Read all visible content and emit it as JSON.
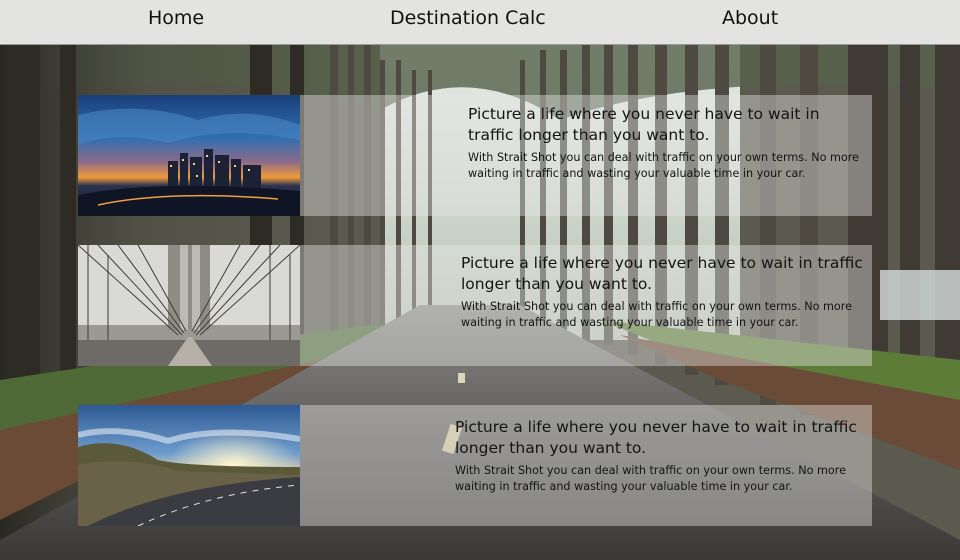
{
  "nav": {
    "home_label": "Home",
    "calc_label": "Destination Calc",
    "about_label": "About"
  },
  "cards": [
    {
      "headline": "Picture a life where you never have to wait in traffic longer than you want to.",
      "body": "With Strait Shot you can deal with traffic on your own terms. No more waiting in traffic and wasting your valuable time in your car.",
      "image": "night-city-skyline"
    },
    {
      "headline": "Picture a life where you never have to wait in traffic longer than you want to.",
      "body": "With Strait Shot you can deal with traffic on your own terms. No more waiting in traffic and wasting your valuable time in your car.",
      "image": "suspension-bridge-walkway"
    },
    {
      "headline": "Picture a life where you never have to wait in traffic longer than you want to.",
      "body": "With Strait Shot you can deal with traffic on your own terms. No more waiting in traffic and wasting your valuable time in your car.",
      "image": "sunset-mountain-road"
    }
  ],
  "background_image": "forest-road",
  "colors": {
    "nav_bg": "#e3e3e1",
    "panel_overlay": "#e8e8e8",
    "text": "#141414"
  }
}
